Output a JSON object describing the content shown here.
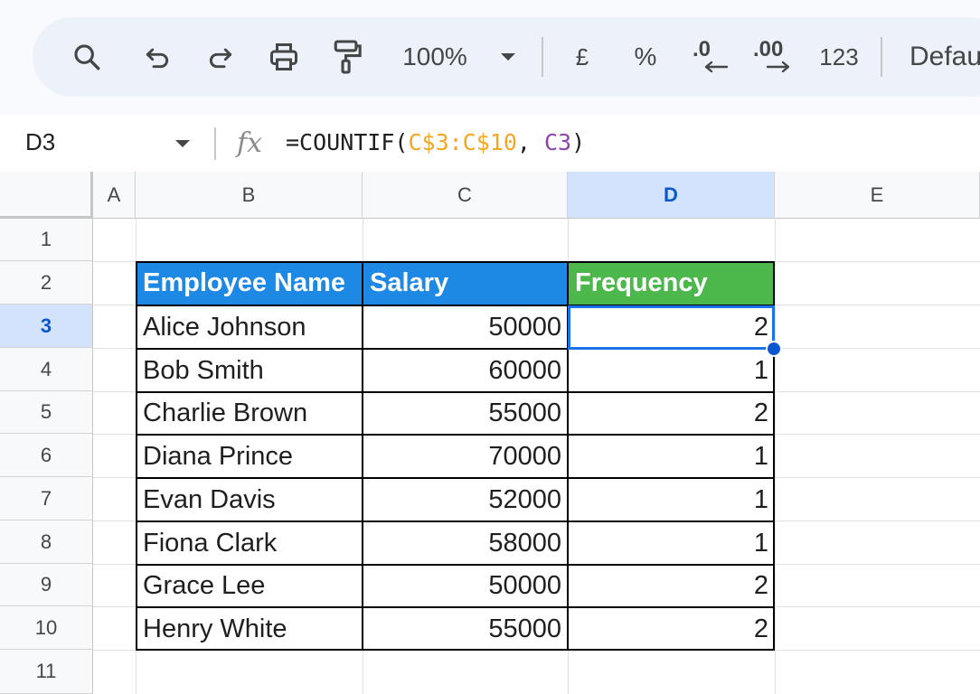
{
  "toolbar": {
    "zoom": "100%",
    "currency": "£",
    "percent": "%",
    "decrease_decimal": ".0",
    "increase_decimal": ".00",
    "number_format": "123",
    "font": "Defau",
    "icons": [
      "search-icon",
      "undo-icon",
      "redo-icon",
      "print-icon",
      "paint-format-icon",
      "chevron-down-icon"
    ]
  },
  "formula_bar": {
    "cell_ref": "D3",
    "fx": "fx",
    "formula_prefix": "=COUNTIF(",
    "formula_range": "C$3:C$10",
    "formula_sep": ", ",
    "formula_ref": "C3",
    "formula_suffix": ")"
  },
  "columns": [
    "A",
    "B",
    "C",
    "D",
    "E"
  ],
  "rows": [
    "1",
    "2",
    "3",
    "4",
    "5",
    "6",
    "7",
    "8",
    "9",
    "10",
    "11"
  ],
  "selected": {
    "column": "D",
    "row": "3"
  },
  "table": {
    "headers": {
      "name": "Employee Name",
      "salary": "Salary",
      "frequency": "Frequency"
    },
    "header_colors": {
      "name": "#1e88e5",
      "salary": "#1e88e5",
      "frequency": "#4cb84c"
    },
    "rows": [
      {
        "name": "Alice Johnson",
        "salary": "50000",
        "frequency": "2"
      },
      {
        "name": "Bob Smith",
        "salary": "60000",
        "frequency": "1"
      },
      {
        "name": "Charlie Brown",
        "salary": "55000",
        "frequency": "2"
      },
      {
        "name": "Diana Prince",
        "salary": "70000",
        "frequency": "1"
      },
      {
        "name": "Evan Davis",
        "salary": "52000",
        "frequency": "1"
      },
      {
        "name": "Fiona Clark",
        "salary": "58000",
        "frequency": "1"
      },
      {
        "name": "Grace Lee",
        "salary": "50000",
        "frequency": "2"
      },
      {
        "name": "Henry White",
        "salary": "55000",
        "frequency": "2"
      }
    ]
  }
}
